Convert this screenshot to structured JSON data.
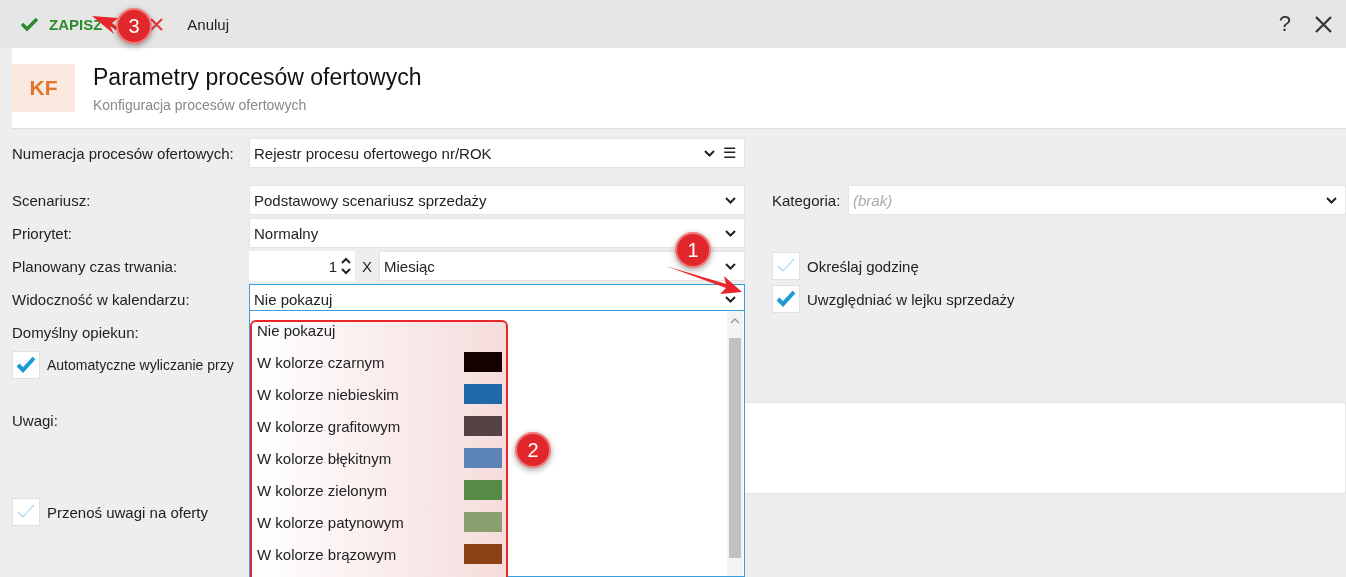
{
  "toolbar": {
    "save_label": "ZAPISZ",
    "cancel_label": "Anuluj",
    "help_label": "?"
  },
  "header": {
    "badge": "KF",
    "title": "Parametry procesów ofertowych",
    "subtitle": "Konfiguracja procesów ofertowych"
  },
  "fields": [
    {
      "kind": "combo",
      "label": "Numeracja procesów ofertowych:",
      "value": "Rejestr procesu ofertowego nr/ROK",
      "menu_glyph": "☰",
      "focused": false
    },
    {
      "kind": "combo",
      "label": "Scenariusz:",
      "value": "Podstawowy scenariusz sprzedaży",
      "focused": false
    },
    {
      "kind": "combo",
      "label": "Priorytet:",
      "value": "Normalny",
      "focused": false
    },
    {
      "kind": "duration",
      "label": "Planowany czas trwania:",
      "amount": "1",
      "times": "X",
      "unit": "Miesiąc"
    },
    {
      "kind": "combo",
      "label": "Widoczność w kalendarzu:",
      "value": "Nie pokazuj",
      "focused": true
    },
    {
      "kind": "label",
      "label": "Domyślny opiekun:"
    },
    {
      "kind": "check",
      "label": "Automatyczne wyliczanie przy",
      "checked": true
    },
    {
      "kind": "notes",
      "label": "Uwagi:"
    },
    {
      "kind": "check",
      "label": "Przenoś uwagi na oferty",
      "checked": false
    }
  ],
  "category": {
    "label": "Kategoria:",
    "placeholder": "(brak)"
  },
  "right_checks": [
    {
      "label": "Określaj godzinę",
      "checked": false
    },
    {
      "label": "Uwzględniać w lejku sprzedaży",
      "checked": true
    }
  ],
  "dropdown": {
    "options": [
      {
        "label": "Nie pokazuj"
      },
      {
        "label": "W kolorze czarnym",
        "color": "#150000"
      },
      {
        "label": "W kolorze niebieskim",
        "color": "#1f69ab"
      },
      {
        "label": "W kolorze grafitowym",
        "color": "#554244"
      },
      {
        "label": "W kolorze błękitnym",
        "color": "#5c84b8"
      },
      {
        "label": "W kolorze zielonym",
        "color": "#578a45"
      },
      {
        "label": "W kolorze patynowym",
        "color": "#88a070"
      },
      {
        "label": "W kolorze brązowym",
        "color": "#8b4114"
      }
    ]
  },
  "annotations": [
    {
      "number": "1"
    },
    {
      "number": "2"
    },
    {
      "number": "3"
    }
  ]
}
